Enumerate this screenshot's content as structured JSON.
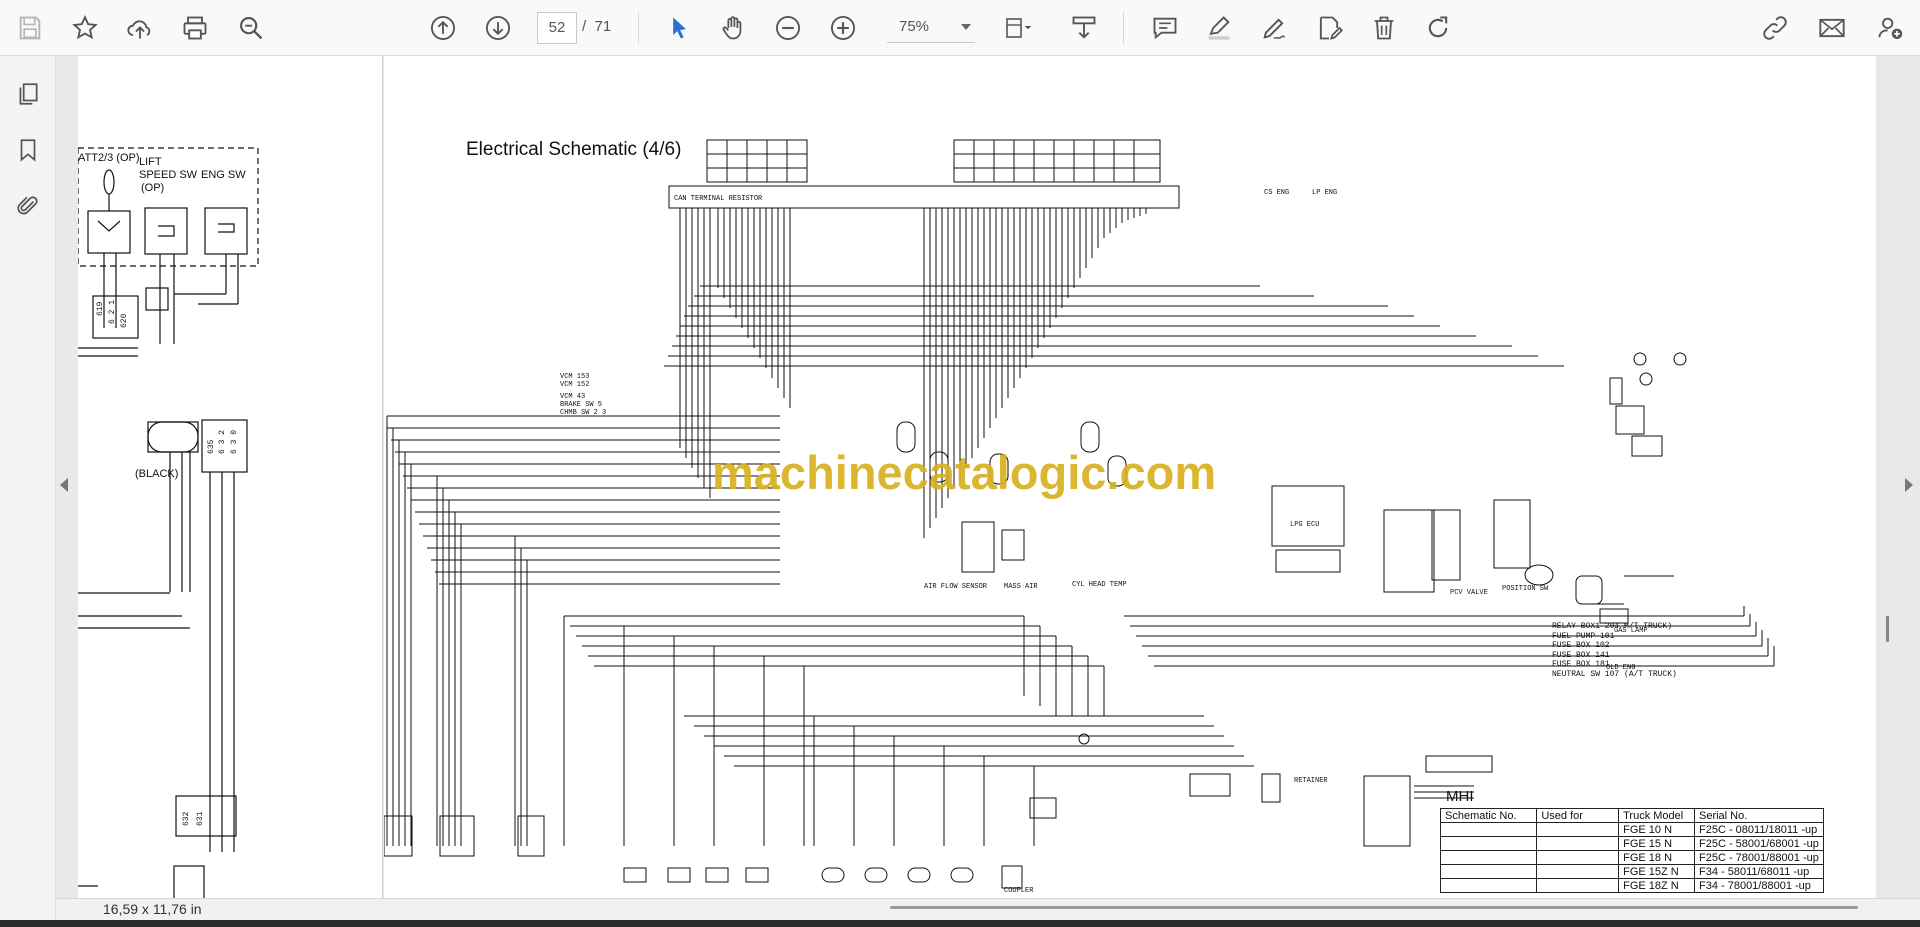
{
  "toolbar": {
    "current_page": "52",
    "page_separator": "/",
    "total_pages": "71",
    "zoom_value": "75%",
    "icons": [
      "save-icon",
      "bookmark-star-icon",
      "cloud-upload-icon",
      "print-icon",
      "zoom-out-search-icon",
      "page-up-icon",
      "page-down-icon",
      "cursor-select-icon",
      "hand-pan-icon",
      "zoom-out-icon",
      "zoom-in-icon",
      "fit-page-icon",
      "download-icon",
      "comment-icon",
      "highlight-icon",
      "sign-icon",
      "edit-document-icon",
      "delete-icon",
      "redo-icon",
      "share-icon",
      "mail-icon",
      "add-user-icon"
    ]
  },
  "sidebar": {
    "icons": [
      "pages-icon",
      "bookmarks-icon",
      "attachments-icon"
    ]
  },
  "document": {
    "title": "Electrical Schematic (4/6)",
    "watermark": "machinecatalogic.com",
    "left_labels": {
      "att": "ATT2/3 (OP)",
      "lift": "LIFT",
      "speed_sw": "SPEED SW",
      "op": "(OP)",
      "eng_sw": "ENG SW",
      "black": "(BLACK)"
    },
    "right_labels": [
      "RELAY BOX1 204 M/T TRUCK)",
      "FUEL PUMP 101",
      "FUSE BOX 102",
      "FUSE BOX 141",
      "FUSE BOX 181",
      "NEUTRAL SW 107 (A/T TRUCK)"
    ],
    "mhi": "MHI",
    "table": {
      "headers": [
        "Schematic No.",
        "Used for",
        "Truck Model",
        "Serial No."
      ],
      "rows": [
        [
          "FGE 10 N",
          "F25C - 08011/18011 -up"
        ],
        [
          "FGE 15 N",
          "F25C - 58001/68001 -up"
        ],
        [
          "FGE 18 N",
          "F25C - 78001/88001 -up"
        ],
        [
          "FGE 15Z N",
          "F34 - 58011/68011 -up"
        ],
        [
          "FGE 18Z N",
          "F34 - 78001/88001 -up"
        ]
      ]
    }
  },
  "status": {
    "page_size": "16,59 x 11,76 in"
  }
}
